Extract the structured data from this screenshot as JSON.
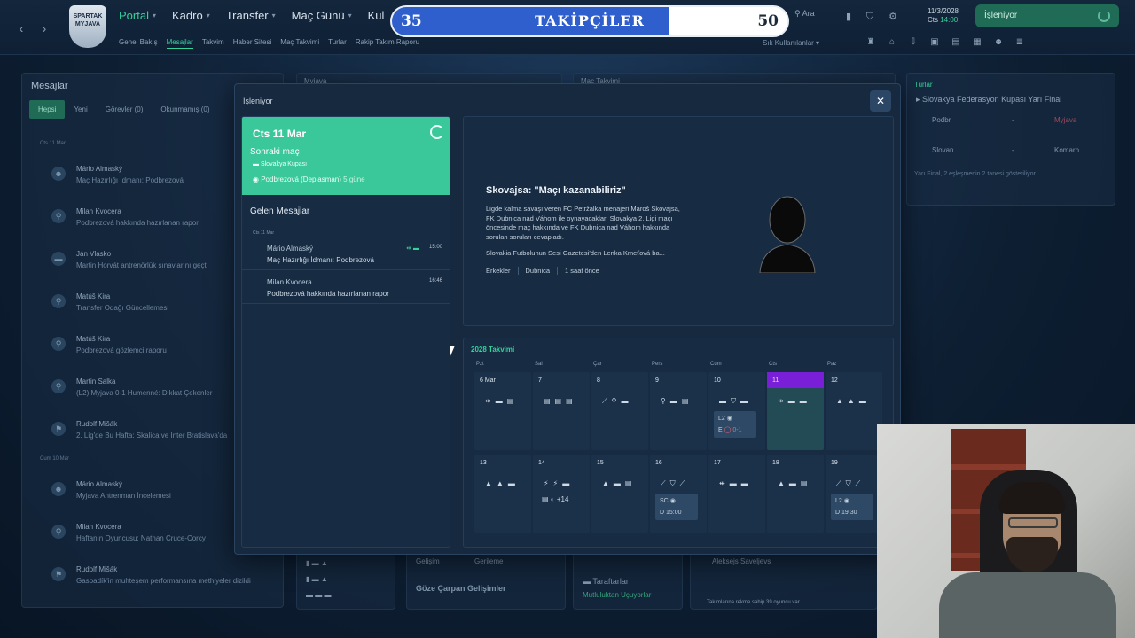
{
  "topbar": {
    "club_crest": "SPARTAK MYJAVA",
    "nav": [
      {
        "label": "Portal",
        "active": true
      },
      {
        "label": "Kadro",
        "active": false
      },
      {
        "label": "Transfer",
        "active": false
      },
      {
        "label": "Maç Günü",
        "active": false
      },
      {
        "label": "Kul",
        "active": false
      }
    ],
    "subnav": [
      "Genel Bakış",
      "Mesajlar",
      "Takvim",
      "Haber Sitesi",
      "Maç Takvimi",
      "Turlar",
      "Rakip Takım Raporu"
    ],
    "search_label": "Ara",
    "date": "11/3/2028",
    "day": "Cts",
    "time": "14:00",
    "processing": "İşleniyor",
    "shortcuts": "Sık Kullanılanlar"
  },
  "followers": {
    "title": "TAKİPÇİLER",
    "current": "35",
    "target": "50",
    "progress": 0.7
  },
  "bg_messages": {
    "title": "Mesajlar",
    "tabs": [
      "Hepsi",
      "Yeni",
      "Görevler (0)",
      "Okunmamış (0)"
    ],
    "group1": "Cts 11 Mar",
    "group2": "Cum 10 Mar",
    "items": [
      {
        "name": "Mário Almaský",
        "subject": "Maç Hazırlığı İdmanı: Podbrezová"
      },
      {
        "name": "Milan Kvocera",
        "subject": "Podbrezová hakkında hazırlanan rapor"
      },
      {
        "name": "Ján Vlasko",
        "subject": "Martin Horvát antrenörlük sınavlarını geçti"
      },
      {
        "name": "Matúš Kira",
        "subject": "Transfer Odağı Güncellemesi"
      },
      {
        "name": "Matúš Kira",
        "subject": "Podbrezová gözlemci raporu"
      },
      {
        "name": "Martin Salka",
        "subject": "(L2) Myjava 0-1 Humenné: Dikkat Çekenler"
      },
      {
        "name": "Rudolf Mišák",
        "subject": "2. Lig'de Bu Hafta: Skalica ve Inter Bratislava'da"
      },
      {
        "name": "Mário Almaský",
        "subject": "Myjava Antrenman İncelemesi"
      },
      {
        "name": "Milan Kvocera",
        "subject": "Haftanın Oyuncusu: Nathan Cruce-Corcy"
      },
      {
        "name": "Rudolf Mišák",
        "subject": "Gaspadík'in muhteşem performansına methiyeler dizildi"
      }
    ]
  },
  "bg_cards": {
    "myjava": "Myjava",
    "mac_takvimi": "Maç Takvimi",
    "gelisim": "Gelişim",
    "gerileme": "Gerileme",
    "goze": "Göze Çarpan Gelişimler",
    "taraftarlar": "Taraftarlar",
    "taraftar_durum": "Mutluluktan Uçuyorlar",
    "aleksejs": "Aleksejs Saveljevs",
    "footer_note": "Takımlarına rekme sahip 39 oyuncu var"
  },
  "right_panel": {
    "title": "Turlar",
    "cup": "Slovakya Federasyon Kupası Yarı Final",
    "row1_team": "Podbr",
    "row1_opp": "Myjava",
    "row2_team": "Slovan",
    "row2_opp": "Komarn",
    "dash": "-",
    "note": "Yarı Final, 2 eşleşmenin 2 tanesi gösteriliyor"
  },
  "modal": {
    "title": "İşleniyor",
    "next_match": {
      "date": "Cts 11 Mar",
      "label": "Sonraki maç",
      "competition": "Slovakya Kupası",
      "opponent": "Podbrezová (Deplasman)",
      "days": "5 güne"
    },
    "inbox": {
      "title": "Gelen Mesajlar",
      "date": "Cts 11 Mar",
      "items": [
        {
          "name": "Mário Almaský",
          "subject": "Maç Hazırlığı İdmanı: Podbrezová",
          "time": "15:00"
        },
        {
          "name": "Milan Kvocera",
          "subject": "Podbrezová hakkında hazırlanan rapor",
          "time": "16:46"
        }
      ]
    },
    "news": {
      "headline": "Skovajsa: \"Maçı kazanabiliriz\"",
      "body": "Ligde kalma savaşı veren FC Petržalka menajeri Maroš Skovajsa, FK Dubnica nad Váhom ile oynayacakları Slovakya 2. Ligi maçı öncesinde maç hakkında ve FK Dubnica nad Váhom hakkında sorulan soruları cevapladı.",
      "source": "Slovakia Futbolunun Sesi Gazetesi'den Lenka Kmeťová ba...",
      "tags": [
        "Erkekler",
        "Dubnica",
        "1 saat önce"
      ]
    },
    "calendar": {
      "title": "2028 Takvimi",
      "days": [
        "Pzt",
        "Sal",
        "Çar",
        "Pers",
        "Cum",
        "Cts",
        "Paz"
      ],
      "week1": [
        {
          "num": "6 Mar",
          "icons": "⇹▬▤"
        },
        {
          "num": "7",
          "icons": "▤▤▤"
        },
        {
          "num": "8",
          "icons": "⟋⚲▬"
        },
        {
          "num": "9",
          "icons": "⚲▬▤"
        },
        {
          "num": "10",
          "icons": "▬⛉▬",
          "match": {
            "comp": "L2",
            "venue": "E",
            "result": "0-1"
          }
        },
        {
          "num": "11",
          "icons": "⇹▬▬",
          "today": true
        },
        {
          "num": "12",
          "icons": "▲▲▬"
        }
      ],
      "week2": [
        {
          "num": "13",
          "icons": "▲▲▬"
        },
        {
          "num": "14",
          "icons": "⚡⚡▬",
          "extra": "▤ ◐ +14"
        },
        {
          "num": "15",
          "icons": "▲▬▤"
        },
        {
          "num": "16",
          "icons": "⟋⛉⟋",
          "match": {
            "comp": "SC",
            "venue": "D",
            "time": "15:00"
          }
        },
        {
          "num": "17",
          "icons": "⇹▬▬"
        },
        {
          "num": "18",
          "icons": "▲▬▤"
        },
        {
          "num": "19",
          "icons": "⟋⛉⟋",
          "match": {
            "comp": "L2",
            "venue": "D",
            "time": "19:30"
          }
        }
      ]
    }
  },
  "colors": {
    "accent": "#35d29a",
    "next_match_card": "#3ac89a",
    "today": "#7a1fd8",
    "follow_fill": "#2f5fcc"
  }
}
